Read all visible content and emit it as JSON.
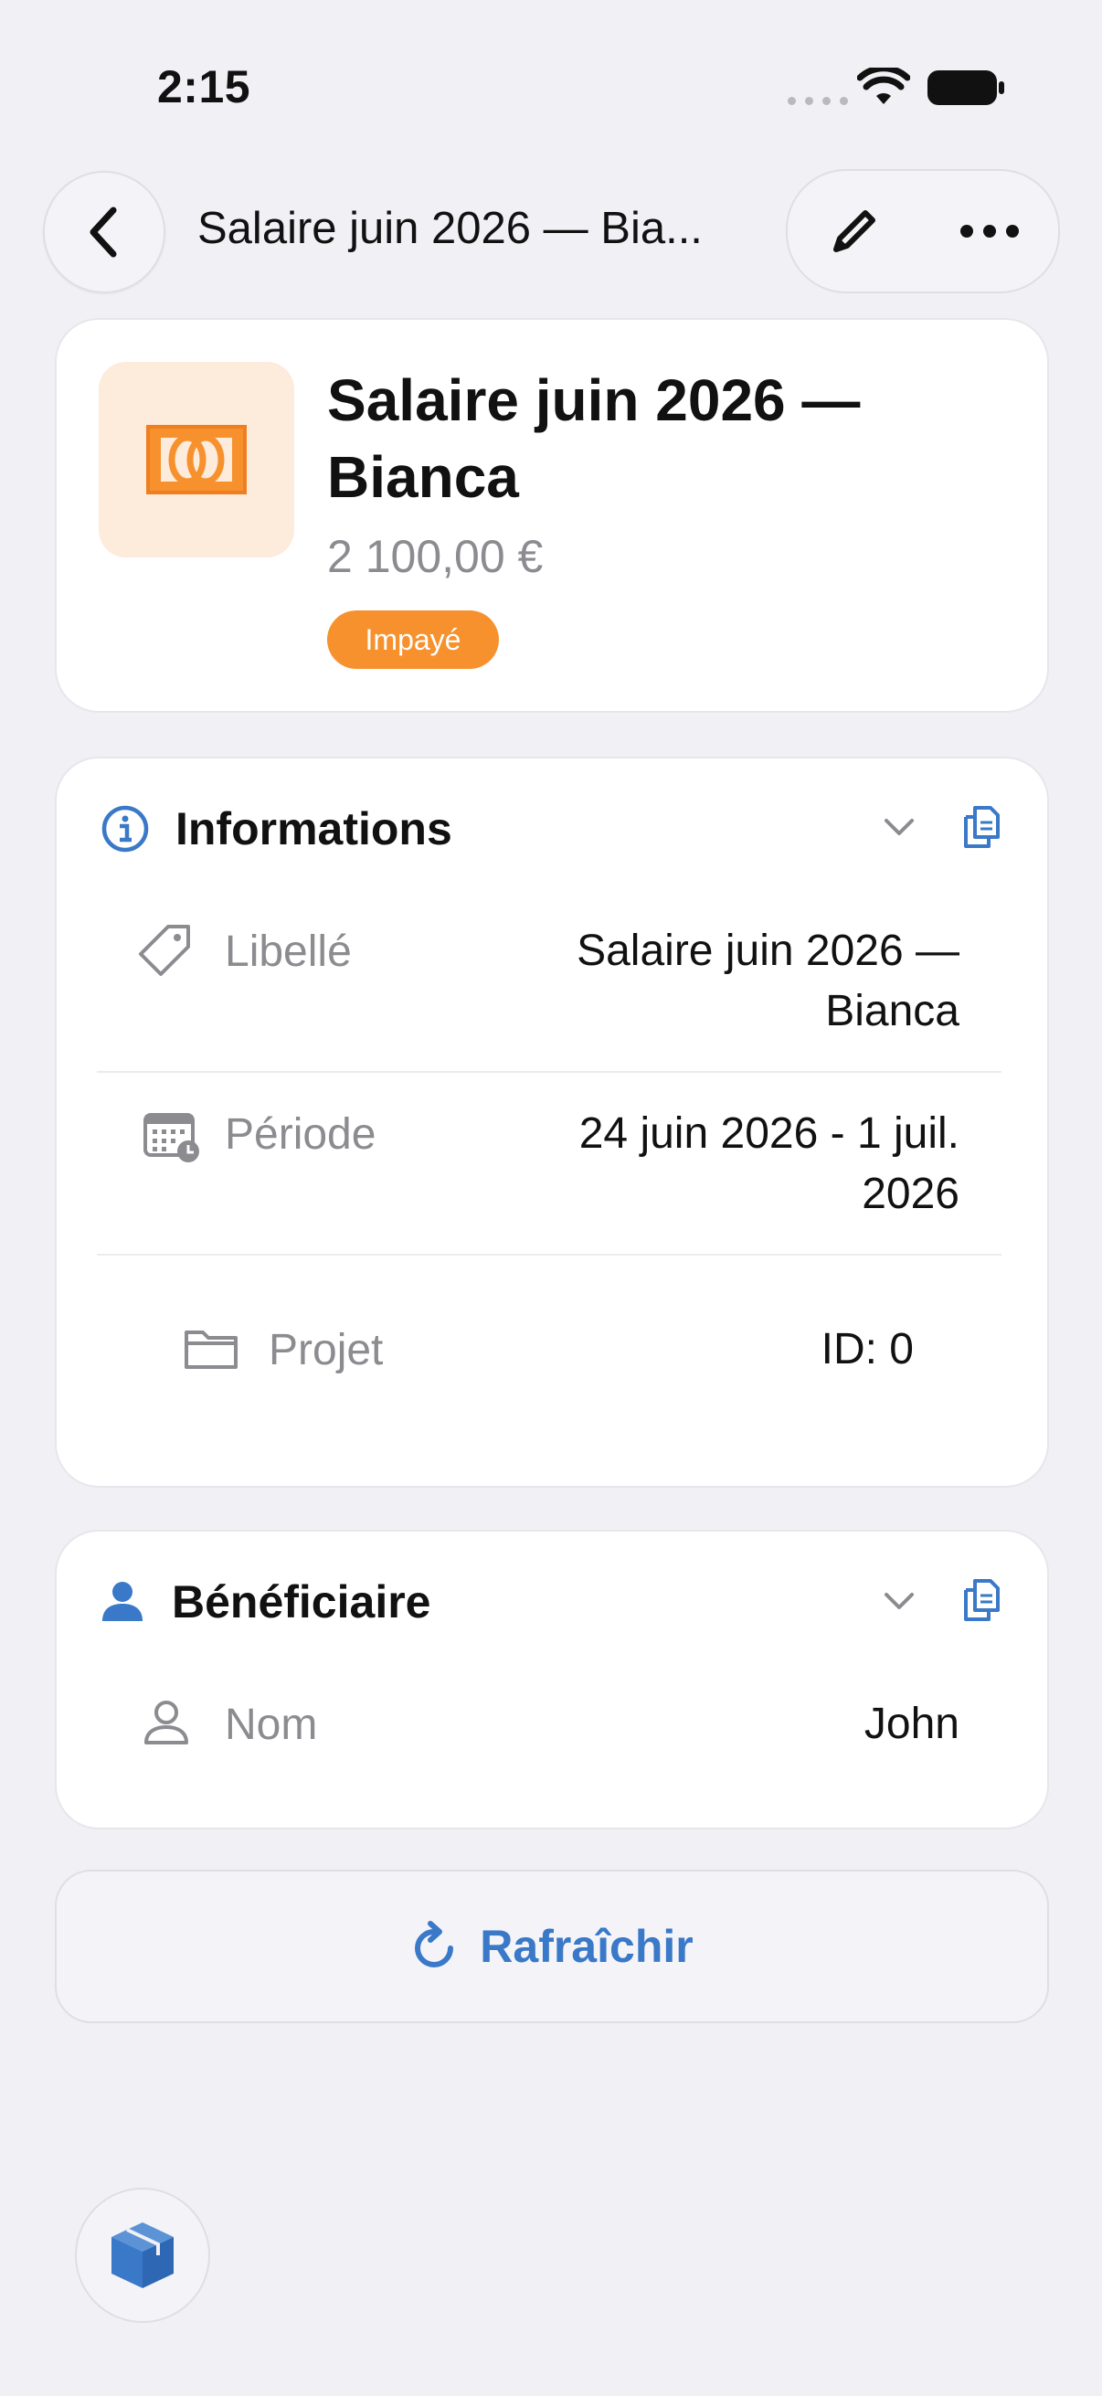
{
  "status_bar": {
    "time": "2:15"
  },
  "nav": {
    "title": "Salaire juin 2026 — Bia..."
  },
  "hero": {
    "title": "Salaire juin 2026 — Bianca",
    "amount": "2 100,00 €",
    "status": "Impayé"
  },
  "informations": {
    "title": "Informations",
    "rows": [
      {
        "label": "Libellé",
        "value": "Salaire juin 2026 — Bianca"
      },
      {
        "label": "Période",
        "value": "24 juin 2026 - 1 juil. 2026"
      },
      {
        "label": "Projet",
        "value": "ID: 0"
      }
    ]
  },
  "beneficiaire": {
    "title": "Bénéficiaire",
    "rows": [
      {
        "label": "Nom",
        "value": "John"
      }
    ]
  },
  "refresh": {
    "label": "Rafraîchir"
  },
  "colors": {
    "accent": "#3a78c8",
    "orange": "#f7912e",
    "orange_bg": "#fdebdb"
  },
  "icons": [
    "chevron-left-icon",
    "pencil-icon",
    "more-icon",
    "banknote-icon",
    "info-icon",
    "chevron-down-icon",
    "copy-icon",
    "tag-icon",
    "calendar-icon",
    "folder-icon",
    "person-icon",
    "refresh-icon",
    "cube-icon"
  ]
}
